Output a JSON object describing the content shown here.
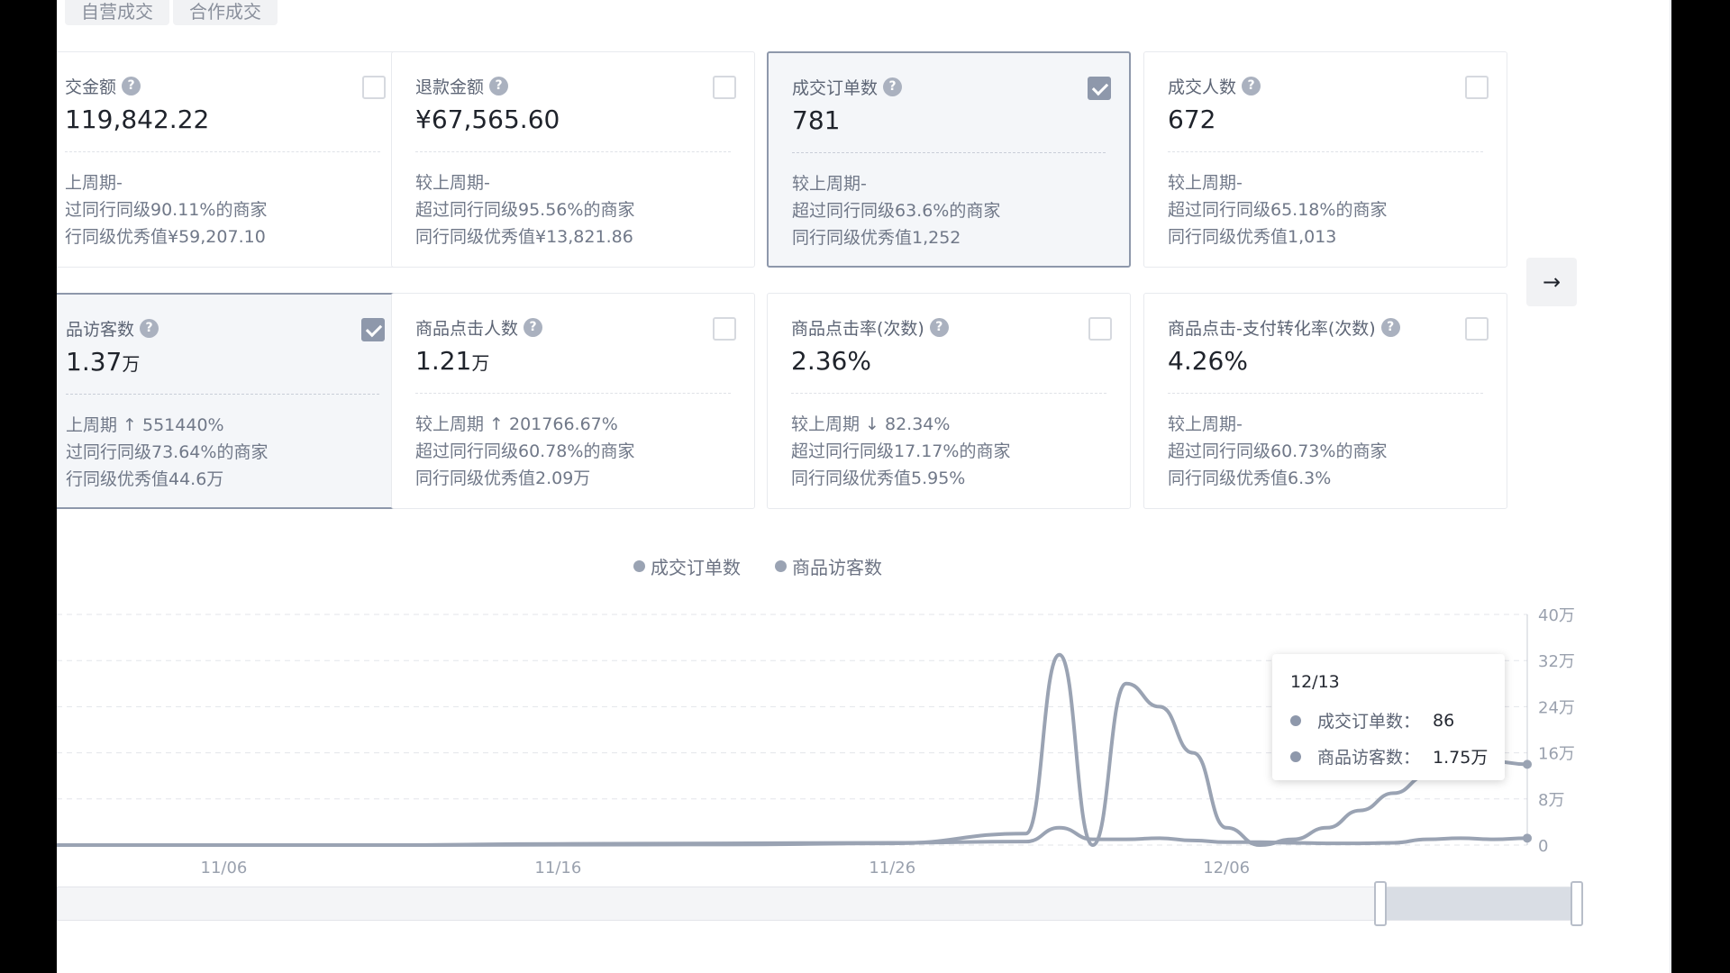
{
  "tabs": [
    "自营成交",
    "合作成交"
  ],
  "cards": [
    {
      "title": "交金额",
      "value": "119,842.22",
      "unit": "",
      "checked": false,
      "selected": false,
      "lines": [
        "上周期-",
        "过同行同级90.11%的商家",
        "行同级优秀值¥59,207.10"
      ]
    },
    {
      "title": "退款金额",
      "value": "¥67,565.60",
      "unit": "",
      "checked": false,
      "selected": false,
      "lines": [
        "较上周期-",
        "超过同行同级95.56%的商家",
        "同行同级优秀值¥13,821.86"
      ]
    },
    {
      "title": "成交订单数",
      "value": "781",
      "unit": "",
      "checked": true,
      "selected": true,
      "lines": [
        "较上周期-",
        "超过同行同级63.6%的商家",
        "同行同级优秀值1,252"
      ]
    },
    {
      "title": "成交人数",
      "value": "672",
      "unit": "",
      "checked": false,
      "selected": false,
      "lines": [
        "较上周期-",
        "超过同行同级65.18%的商家",
        "同行同级优秀值1,013"
      ]
    },
    {
      "title": "品访客数",
      "value": "1.37",
      "unit": "万",
      "checked": true,
      "selected": true,
      "lines": [
        "上周期 ↑ 551440%",
        "过同行同级73.64%的商家",
        "行同级优秀值44.6万"
      ]
    },
    {
      "title": "商品点击人数",
      "value": "1.21",
      "unit": "万",
      "checked": false,
      "selected": false,
      "lines": [
        "较上周期 ↑ 201766.67%",
        "超过同行同级60.78%的商家",
        "同行同级优秀值2.09万"
      ]
    },
    {
      "title": "商品点击率(次数)",
      "value": "2.36%",
      "unit": "",
      "checked": false,
      "selected": false,
      "lines": [
        "较上周期 ↓ 82.34%",
        "超过同行同级17.17%的商家",
        "同行同级优秀值5.95%"
      ]
    },
    {
      "title": "商品点击-支付转化率(次数)",
      "value": "4.26%",
      "unit": "",
      "checked": false,
      "selected": false,
      "lines": [
        "较上周期-",
        "超过同行同级60.73%的商家",
        "同行同级优秀值6.3%"
      ]
    }
  ],
  "help_icon_glyph": "?",
  "next_icon_glyph": "→",
  "legend": [
    "成交订单数",
    "商品访客数"
  ],
  "tooltip": {
    "date": "12/13",
    "rows": [
      {
        "label": "成交订单数：",
        "value": "86"
      },
      {
        "label": "商品访客数：",
        "value": "1.75万"
      }
    ]
  },
  "chart_data": {
    "type": "line",
    "x_ticks": [
      "11/06",
      "11/16",
      "11/26",
      "12/06"
    ],
    "y_ticks": [
      "40万",
      "32万",
      "24万",
      "16万",
      "8万",
      "0"
    ],
    "ylim": [
      0,
      400000
    ],
    "series": [
      {
        "name": "成交订单数",
        "color": "#9aa3b3",
        "x": [
          0,
          5,
          10,
          15,
          20,
          25,
          29,
          30,
          31,
          32,
          33,
          34,
          35,
          36,
          37,
          38,
          39,
          40,
          41,
          42,
          43,
          44
        ],
        "y": [
          0,
          0,
          0,
          2000,
          3000,
          4000,
          6000,
          30000,
          10000,
          10000,
          12000,
          8000,
          5000,
          5000,
          4000,
          3000,
          3000,
          4000,
          10000,
          12000,
          10000,
          12000
        ]
      },
      {
        "name": "商品访客数",
        "color": "#9aa3b3",
        "x": [
          0,
          5,
          10,
          15,
          20,
          25,
          29,
          30,
          31,
          32,
          33,
          34,
          35,
          36,
          37,
          38,
          39,
          40,
          41,
          42,
          43,
          44
        ],
        "y": [
          0,
          0,
          0,
          500,
          1000,
          3000,
          20000,
          330000,
          0,
          280000,
          240000,
          160000,
          30000,
          0,
          10000,
          30000,
          60000,
          90000,
          120000,
          170000,
          145000,
          140000
        ]
      }
    ]
  },
  "colors": {
    "accent": "#8e98ab",
    "border": "#e8eaee",
    "text_muted": "#707888"
  }
}
